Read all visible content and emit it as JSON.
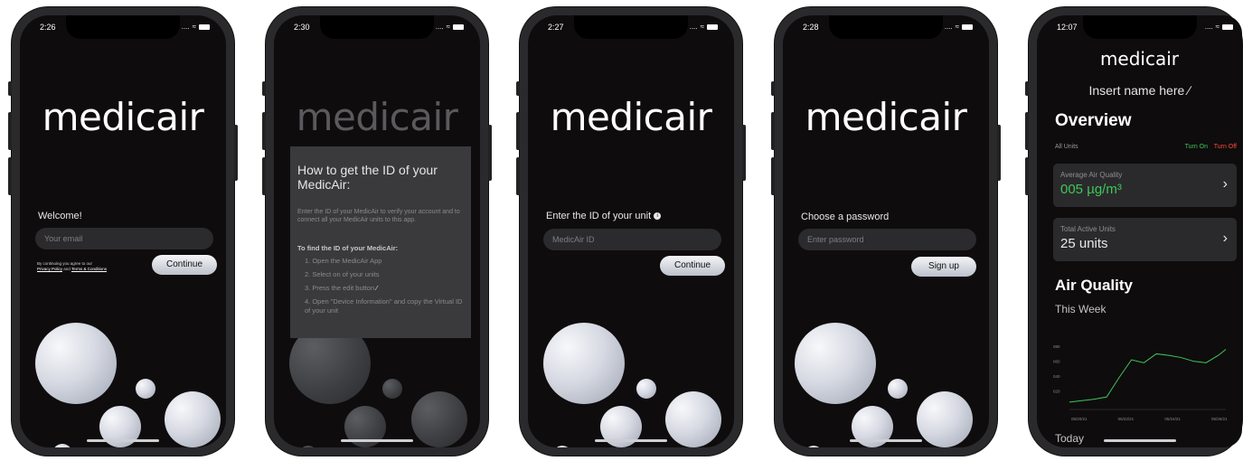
{
  "brand": "medicair",
  "screens": [
    {
      "time": "2:26",
      "welcome_label": "Welcome!",
      "email_placeholder": "Your email",
      "legal_prefix": "By continuing you agree to our",
      "legal_privacy": "Privacy Policy",
      "legal_and": "and",
      "legal_terms": "Terms & Conditions",
      "continue_label": "Continue"
    },
    {
      "time": "2:30",
      "modal_title": "How to get the ID of your MedicAir:",
      "modal_text": "Enter the ID of your MedicAir to verify your account and to connect all your MedicAir units to this app.",
      "modal_subtitle": "To find the ID of your MedicAir:",
      "steps": [
        "1. Open the MedicAir App",
        "2. Select on of your units",
        "3. Press the edit button",
        "4. Open \"Device Information\" and copy the Virtual ID of your unit"
      ]
    },
    {
      "time": "2:27",
      "id_label": "Enter the ID of your unit",
      "id_placeholder": "MedicAir ID",
      "continue_label": "Continue"
    },
    {
      "time": "2:28",
      "password_label": "Choose a password",
      "password_placeholder": "Enter password",
      "signup_label": "Sign up"
    },
    {
      "time": "12:07",
      "name_placeholder": "Insert name here",
      "overview_title": "Overview",
      "all_units": "All Units",
      "turn_on": "Turn On",
      "turn_off": "Turn Off",
      "avg_title": "Average Air Quality",
      "avg_value": "005 µg/m³",
      "total_title": "Total Active Units",
      "total_value": "25 units",
      "air_title": "Air Quality",
      "week_label": "This Week",
      "today_label": "Today"
    }
  ],
  "colors": {
    "background": "#0e0c0d",
    "accent_green": "#3ec75a",
    "accent_red": "#ff4a3c",
    "field": "#2b2a2c"
  },
  "chart_data": {
    "type": "line",
    "x": [
      "05/20/21",
      "05/22/21",
      "05/24/21",
      "05/26/21"
    ],
    "yticks": [
      "080",
      "060",
      "040",
      "020"
    ],
    "ylim": [
      0,
      90
    ],
    "series": [
      {
        "x": [
          0,
          0.5,
          1,
          1.5,
          2,
          2.5,
          3,
          3.5,
          4,
          4.5,
          5,
          5.5,
          6,
          6.3
        ],
        "values": [
          5,
          7,
          9,
          12,
          38,
          62,
          58,
          70,
          68,
          65,
          60,
          58,
          68,
          76
        ]
      }
    ],
    "grid": false
  }
}
